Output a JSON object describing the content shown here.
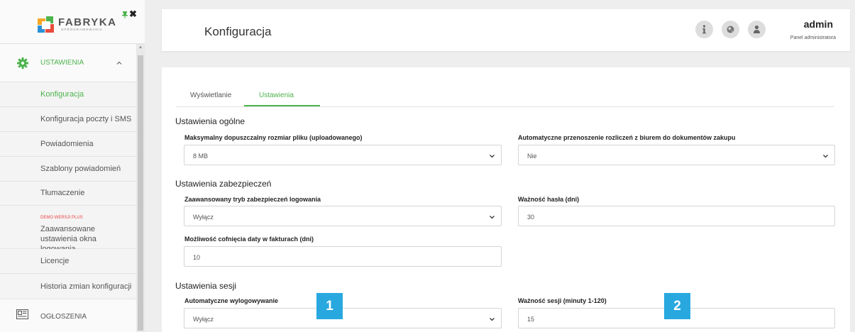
{
  "sidebar": {
    "logo": {
      "text": "FABRYKA",
      "sub": "OPROGRAMOWANIA"
    },
    "close_glyph": "✖",
    "menu_head": {
      "label": "USTAWIENIA",
      "icon": "gear-icon"
    },
    "items": [
      {
        "label": "Konfiguracja",
        "active": true
      },
      {
        "label": "Konfiguracja poczty i SMS"
      },
      {
        "label": "Powiadomienia"
      },
      {
        "label": "Szablony powiadomień"
      },
      {
        "label": "Tłumaczenie"
      },
      {
        "badge": "DEMO WERSJI PLUS",
        "label": "Zaawansowane ustawienia okna logowania"
      },
      {
        "label": "Licencje"
      },
      {
        "label": "Historia zmian konfiguracji"
      }
    ],
    "ogloszenia": {
      "label": "OGŁOSZENIA",
      "icon": "newspaper-icon"
    }
  },
  "header": {
    "title": "Konfiguracja",
    "icons": [
      "info-icon",
      "globe-icon",
      "user-icon"
    ],
    "user_name": "admin",
    "user_role": "Panel administratora"
  },
  "tabs": [
    {
      "label": "Wyświetlanie"
    },
    {
      "label": "Ustawienia",
      "active": true
    }
  ],
  "sections": {
    "general": {
      "title": "Ustawienia ogólne",
      "max_file_label": "Maksymalny dopuszczalny rozmiar pliku (uploadowanego)",
      "max_file_value": "8 MB",
      "auto_move_label": "Automatyczne przenoszenie rozliczeń z biurem do dokumentów zakupu",
      "auto_move_value": "Nie"
    },
    "security": {
      "title": "Ustawienia zabezpieczeń",
      "adv_mode_label": "Zaawansowany tryb zabezpieczeń logowania",
      "adv_mode_value": "Wyłącz",
      "pwd_validity_label": "Ważność hasła (dni)",
      "pwd_validity_value": "30",
      "invoice_date_label": "Możliwość cofnięcia daty w fakturach (dni)",
      "invoice_date_value": "10"
    },
    "session": {
      "title": "Ustawienia sesji",
      "auto_logout_label": "Automatyczne wylogowywanie",
      "auto_logout_value": "Wyłącz",
      "session_validity_label": "Ważność sesji (minuty 1-120)",
      "session_validity_value": "15"
    }
  },
  "markers": [
    "1",
    "2"
  ],
  "colors": {
    "accent": "#4db34d",
    "marker": "#29a8e0"
  }
}
